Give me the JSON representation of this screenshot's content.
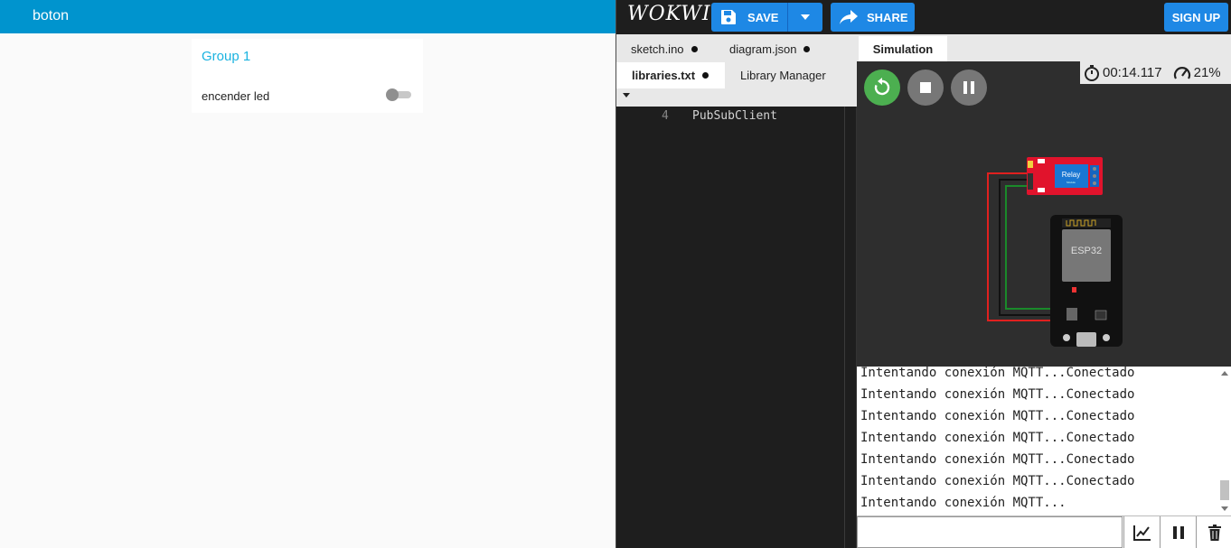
{
  "dashboard": {
    "title": "boton",
    "group": {
      "title": "Group 1",
      "switch_label": "encender led",
      "switch_state": "off"
    }
  },
  "wokwi": {
    "logo": "WOKWI",
    "save_label": "SAVE",
    "share_label": "SHARE",
    "signup_label": "SIGN UP",
    "tabs": [
      {
        "label": "sketch.ino",
        "unsaved": true
      },
      {
        "label": "diagram.json",
        "unsaved": true
      },
      {
        "label": "libraries.txt",
        "unsaved": true,
        "active": true
      },
      {
        "label": "Library Manager",
        "unsaved": false
      }
    ],
    "code": {
      "line_number": "4",
      "text": "PubSubClient"
    },
    "simulation": {
      "tab_label": "Simulation",
      "timer": "00:14.117",
      "speed": "21%",
      "restart_color": "#4caf50",
      "parts": {
        "relay": "Relay",
        "relay_sub": "Module",
        "mcu": "ESP32"
      }
    },
    "serial": {
      "lines": [
        "Intentando conexión MQTT...Conectado",
        "Intentando conexión MQTT...Conectado",
        "Intentando conexión MQTT...Conectado",
        "Intentando conexión MQTT...Conectado",
        "Intentando conexión MQTT...Conectado",
        "Intentando conexión MQTT...Conectado",
        "Intentando conexión MQTT..."
      ],
      "input_value": ""
    }
  },
  "colors": {
    "dashboard_header": "#0094ce",
    "group_title": "#1bb3e0",
    "wokwi_blue": "#1e88e5"
  }
}
